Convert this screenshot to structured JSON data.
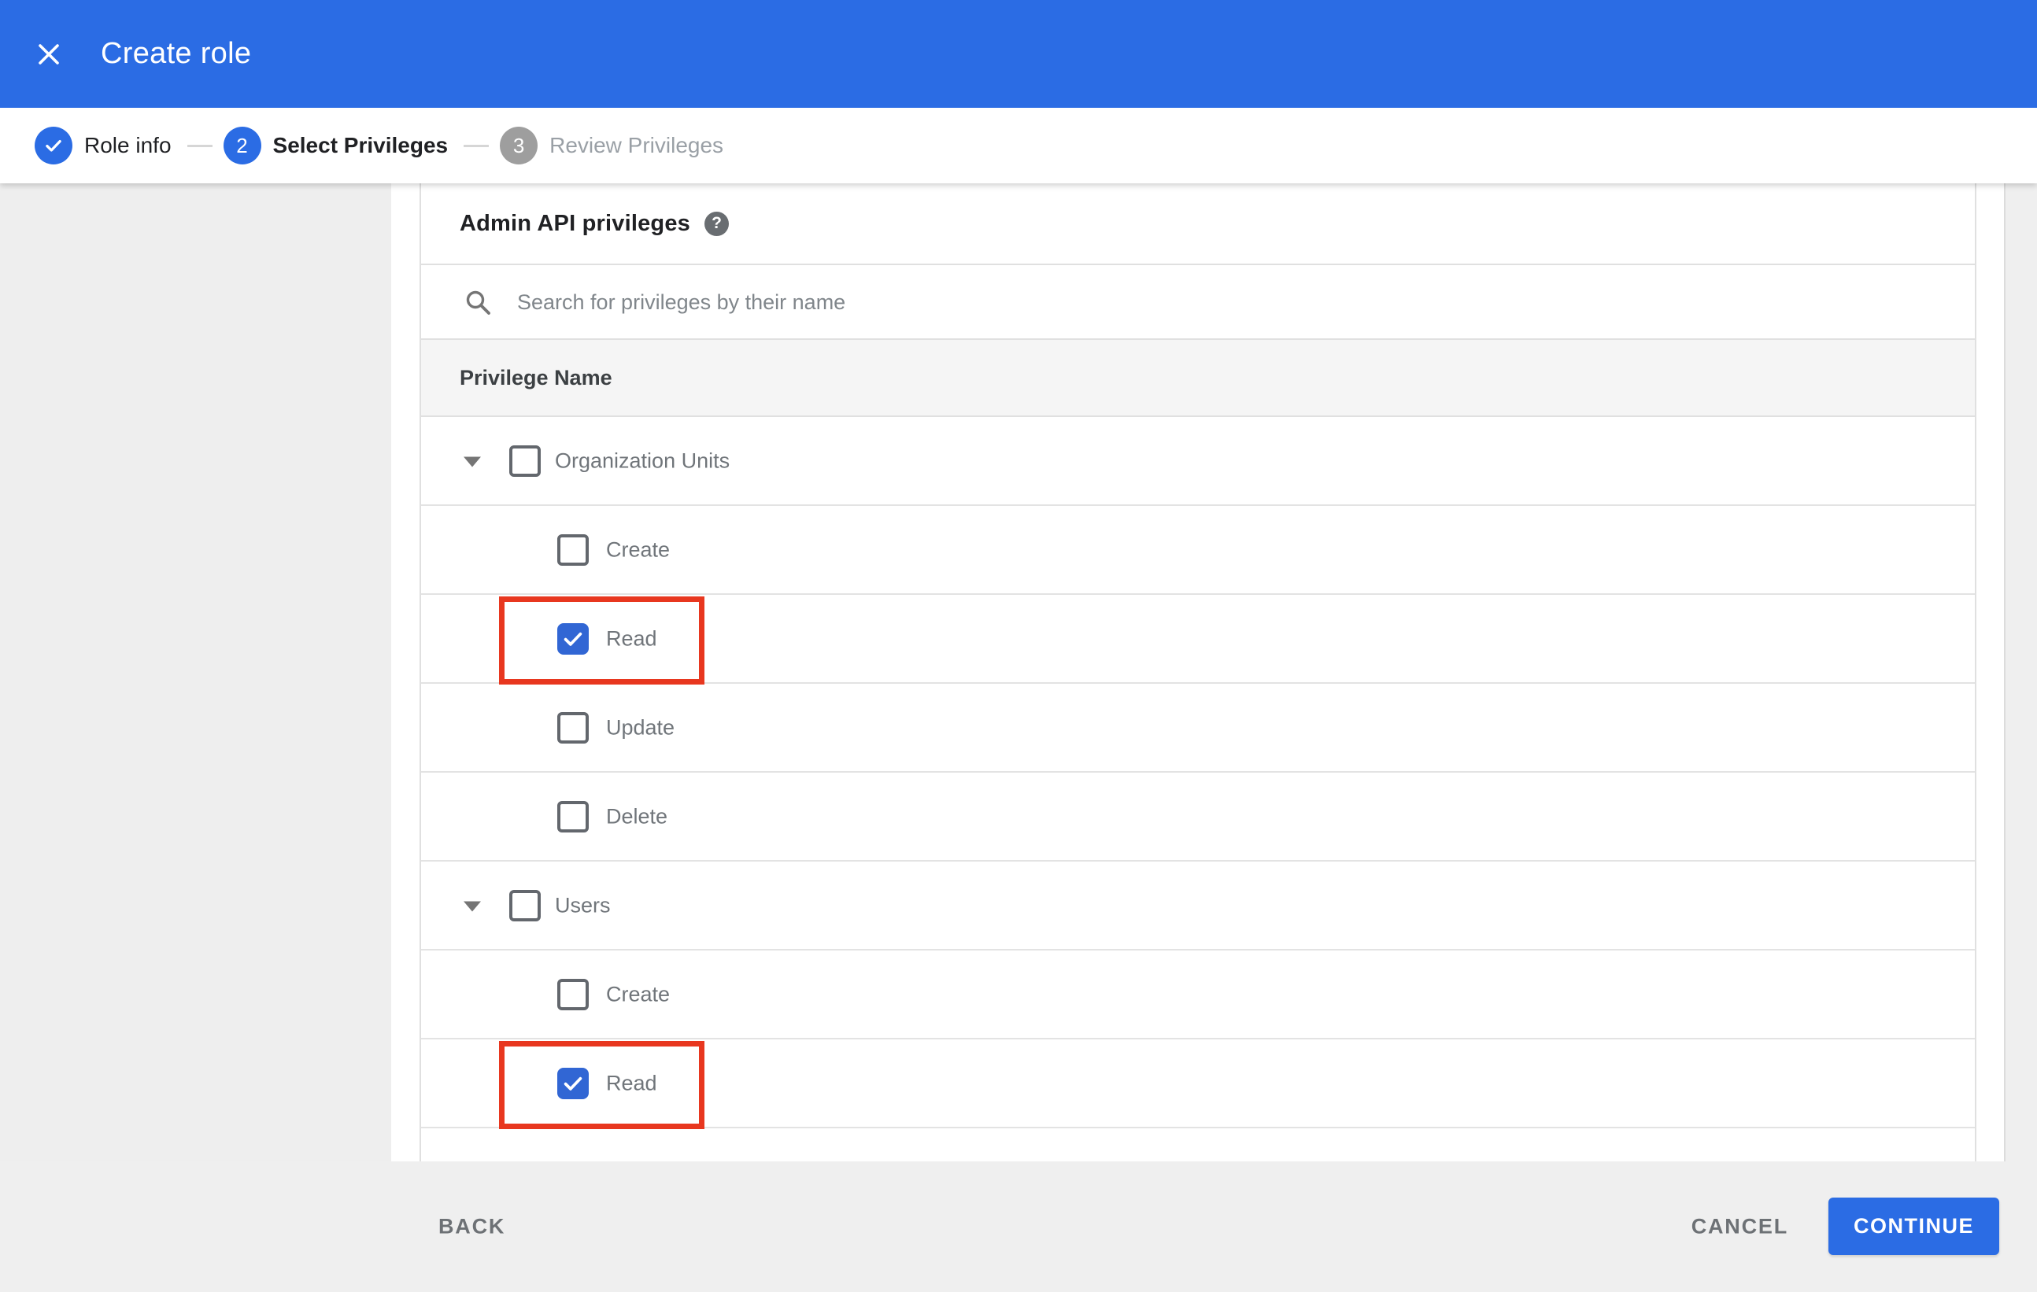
{
  "header": {
    "title": "Create role"
  },
  "stepper": {
    "steps": [
      {
        "label": "Role info",
        "state": "completed"
      },
      {
        "number": "2",
        "label": "Select Privileges",
        "state": "active"
      },
      {
        "number": "3",
        "label": "Review Privileges",
        "state": "upcoming"
      }
    ]
  },
  "content": {
    "section_title": "Admin API privileges",
    "help_glyph": "?",
    "search": {
      "placeholder": "Search for privileges by their name",
      "value": ""
    },
    "table": {
      "column_header": "Privilege Name",
      "rows": [
        {
          "label": "Organization Units",
          "type": "parent",
          "expanded": true,
          "checked": false,
          "highlighted": false
        },
        {
          "label": "Create",
          "type": "child",
          "checked": false,
          "highlighted": false
        },
        {
          "label": "Read",
          "type": "child",
          "checked": true,
          "highlighted": true
        },
        {
          "label": "Update",
          "type": "child",
          "checked": false,
          "highlighted": false
        },
        {
          "label": "Delete",
          "type": "child",
          "checked": false,
          "highlighted": false
        },
        {
          "label": "Users",
          "type": "parent",
          "expanded": true,
          "checked": false,
          "highlighted": false
        },
        {
          "label": "Create",
          "type": "child",
          "checked": false,
          "highlighted": false
        },
        {
          "label": "Read",
          "type": "child",
          "checked": true,
          "highlighted": true
        }
      ]
    }
  },
  "footer": {
    "back_label": "BACK",
    "cancel_label": "CANCEL",
    "continue_label": "CONTINUE"
  },
  "colors": {
    "banner_blue": "#2b6ce4",
    "checkbox_blue": "#3166d4",
    "highlight_red": "#e8371f",
    "inactive_step_gray": "#9e9e9e",
    "header_row_gray": "#f5f5f5",
    "page_gray": "#eeeeee"
  }
}
